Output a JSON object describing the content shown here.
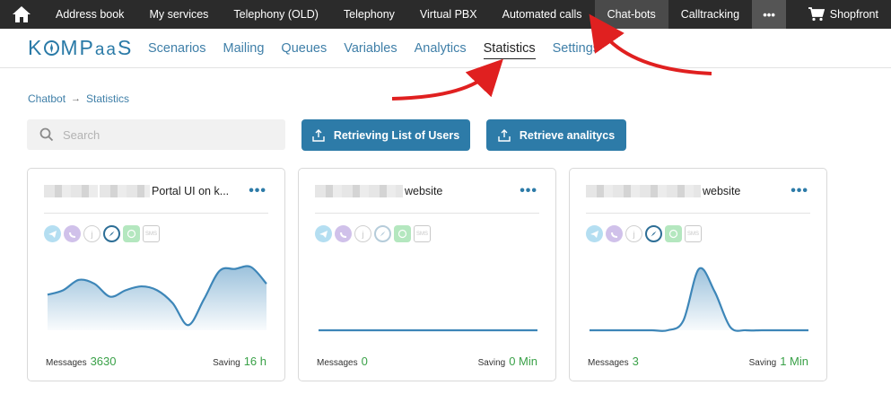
{
  "topbar": {
    "items": [
      {
        "label": "Address book"
      },
      {
        "label": "My services"
      },
      {
        "label": "Telephony (OLD)"
      },
      {
        "label": "Telephony"
      },
      {
        "label": "Virtual PBX"
      },
      {
        "label": "Automated calls"
      },
      {
        "label": "Chat-bots",
        "active": true
      },
      {
        "label": "Calltracking"
      }
    ],
    "more_label": "•••",
    "shop_label": "Shopfront"
  },
  "logo": {
    "text_a": "K",
    "text_b": "MP",
    "text_c": "aa",
    "text_d": "S"
  },
  "tabs": [
    {
      "label": "Scenarios"
    },
    {
      "label": "Mailing"
    },
    {
      "label": "Queues"
    },
    {
      "label": "Variables"
    },
    {
      "label": "Analytics"
    },
    {
      "label": "Statistics",
      "active": true
    },
    {
      "label": "Settings"
    }
  ],
  "breadcrumb": {
    "root": "Chatbot",
    "arrow": "→",
    "current": "Statistics"
  },
  "search": {
    "placeholder": "Search",
    "value": ""
  },
  "buttons": {
    "users": "Retrieving List of Users",
    "analytics": "Retrieve analityсs"
  },
  "colors": {
    "accent": "#2d7ba8",
    "topbar": "#2b2b2b",
    "value_green": "#3aa148"
  },
  "cards": [
    {
      "title_visible": "Portal UI on k...",
      "menu": "•••",
      "messages_label": "Messages",
      "messages_value": "3630",
      "saving_label": "Saving",
      "saving_value": "16 h",
      "chart_points": [
        0.55,
        0.62,
        0.78,
        0.72,
        0.52,
        0.62,
        0.68,
        0.62,
        0.42,
        0.08,
        0.48,
        0.92,
        0.95,
        0.98,
        0.72
      ],
      "channels": [
        "telegram",
        "viber",
        "jivo",
        "compass-active",
        "whatsapp",
        "sms"
      ]
    },
    {
      "title_visible": "website",
      "menu": "•••",
      "messages_label": "Messages",
      "messages_value": "0",
      "saving_label": "Saving",
      "saving_value": "0 Min",
      "chart_points": [
        0,
        0,
        0,
        0,
        0,
        0,
        0,
        0,
        0,
        0,
        0,
        0,
        0,
        0,
        0
      ],
      "channels": [
        "telegram",
        "viber",
        "jivo",
        "compass",
        "whatsapp",
        "sms"
      ]
    },
    {
      "title_visible": "website",
      "menu": "•••",
      "messages_label": "Messages",
      "messages_value": "3",
      "saving_label": "Saving",
      "saving_value": "1 Min",
      "chart_points": [
        0,
        0,
        0,
        0,
        0,
        0,
        0.15,
        0.95,
        0.6,
        0.05,
        0,
        0,
        0,
        0,
        0
      ],
      "channels": [
        "telegram",
        "viber",
        "jivo",
        "compass-active",
        "whatsapp",
        "sms"
      ]
    }
  ]
}
